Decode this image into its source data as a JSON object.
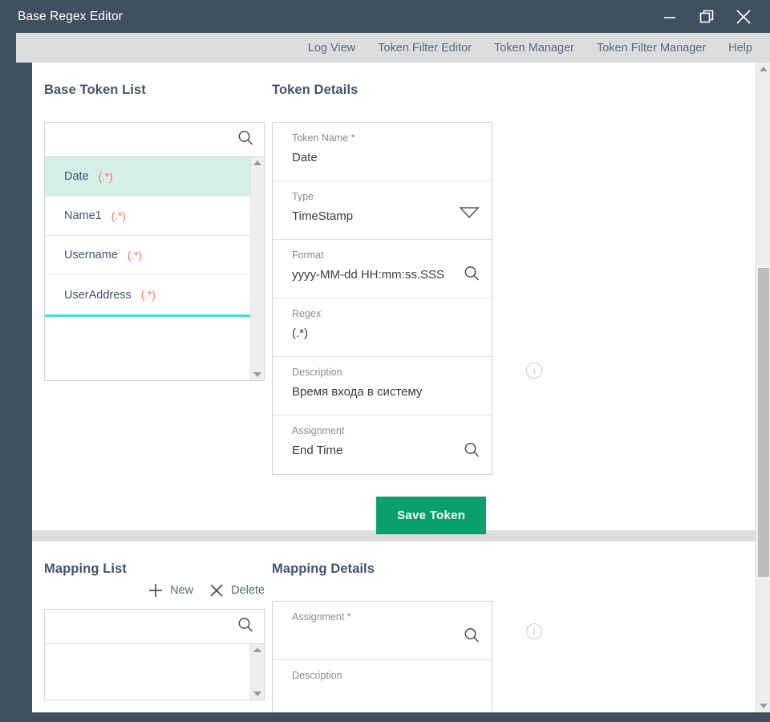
{
  "window": {
    "title": "Base Regex Editor",
    "controls": [
      {
        "name": "minimize",
        "label": "Minimize"
      },
      {
        "name": "restore",
        "label": "Restore"
      },
      {
        "name": "close",
        "label": "Close"
      }
    ],
    "colors": {
      "titlebar": "#3f5161",
      "menustrip": "#dcdcdc",
      "accent_green": "#0aa06e",
      "selected_row": "#d4f0e6",
      "regex_text": "#f0765a",
      "drop_line": "#3ce3d5",
      "heading": "#44546a"
    }
  },
  "menu": {
    "items": [
      {
        "label": "Log View"
      },
      {
        "label": "Token Filter Editor"
      },
      {
        "label": "Token Manager"
      },
      {
        "label": "Token Filter Manager"
      },
      {
        "label": "Help"
      }
    ]
  },
  "base_token_list": {
    "title": "Base Token List",
    "search": {
      "value": "",
      "placeholder": ""
    },
    "items": [
      {
        "name": "Date",
        "regex": "(.*)",
        "selected": true
      },
      {
        "name": "Name1",
        "regex": "(.*)",
        "selected": false
      },
      {
        "name": "Username",
        "regex": "(.*)",
        "selected": false
      },
      {
        "name": "UserAddress",
        "regex": "(.*)",
        "selected": false
      }
    ]
  },
  "token_details": {
    "title": "Token Details",
    "fields": [
      {
        "label": "Token Name *",
        "value": "Date",
        "affix": "none"
      },
      {
        "label": "Type",
        "value": "TimeStamp",
        "affix": "chevron-down"
      },
      {
        "label": "Format",
        "value": "yyyy-MM-dd HH:mm:ss.SSS",
        "affix": "search"
      },
      {
        "label": "Regex",
        "value": "(.*)",
        "affix": "none"
      },
      {
        "label": "Description",
        "value": "Время входа в систему",
        "affix": "none"
      },
      {
        "label": "Assignment",
        "value": "End Time",
        "affix": "search"
      }
    ],
    "info_icon": "i",
    "save_button": "Save Token"
  },
  "mapping_list": {
    "title": "Mapping List",
    "tools": [
      {
        "label": "New",
        "icon": "plus-icon"
      },
      {
        "label": "Delete",
        "icon": "close-x-icon"
      }
    ],
    "search": {
      "value": "",
      "placeholder": ""
    },
    "items": []
  },
  "mapping_details": {
    "title": "Mapping Details",
    "fields": [
      {
        "label": "Assignment *",
        "value": "",
        "affix": "search"
      },
      {
        "label": "Description",
        "value": "",
        "affix": "none"
      }
    ],
    "info_icon": "i"
  }
}
